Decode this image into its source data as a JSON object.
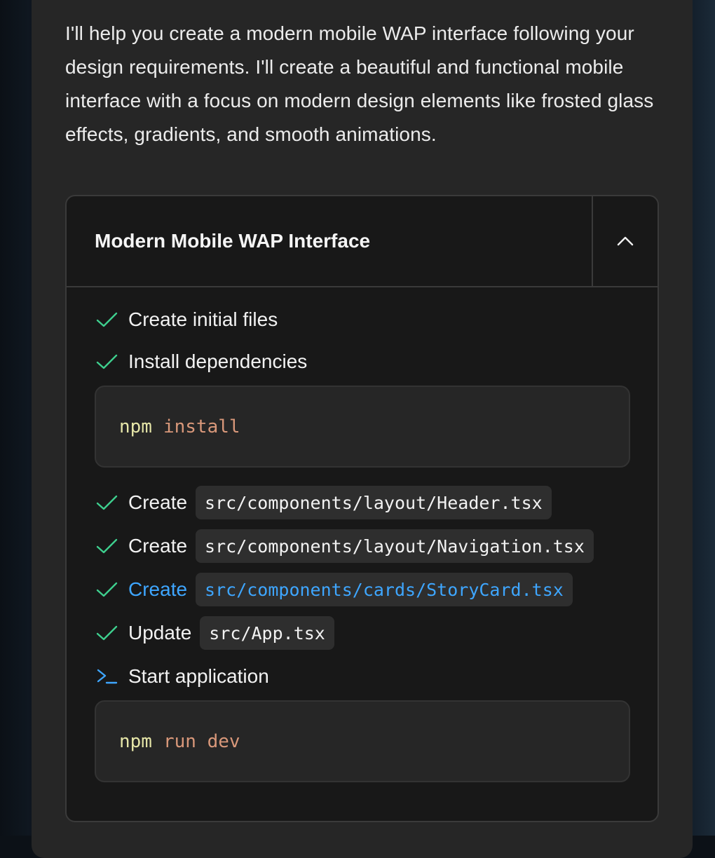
{
  "message": {
    "text": "I'll help you create a modern mobile WAP interface following your design requirements. I'll create a beautiful and functional mobile interface with a focus on modern design elements like frosted glass effects, gradients, and smooth animations."
  },
  "artifact": {
    "title": "Modern Mobile WAP Interface",
    "collapse_icon": "chevron-up-icon",
    "steps": [
      {
        "status": "done",
        "icon": "check-icon",
        "label": "Create initial files"
      },
      {
        "status": "done",
        "icon": "check-icon",
        "label": "Install dependencies"
      },
      {
        "status": "done",
        "icon": "check-icon",
        "label": "Create",
        "file": "src/components/layout/Header.tsx"
      },
      {
        "status": "done",
        "icon": "check-icon",
        "label": "Create",
        "file": "src/components/layout/Navigation.tsx"
      },
      {
        "status": "active",
        "icon": "check-icon",
        "label": "Create",
        "file": "src/components/cards/StoryCard.tsx"
      },
      {
        "status": "done",
        "icon": "check-icon",
        "label": "Update",
        "file": "src/App.tsx"
      },
      {
        "status": "running",
        "icon": "terminal-icon",
        "label": "Start application"
      }
    ],
    "commands": [
      {
        "program": "npm",
        "args": "install"
      },
      {
        "program": "npm",
        "args": "run dev"
      }
    ]
  },
  "colors": {
    "check": "#3ecf8e",
    "active": "#3ea6ff",
    "command_program": "#e6e6a8",
    "command_args": "#d9987a"
  }
}
